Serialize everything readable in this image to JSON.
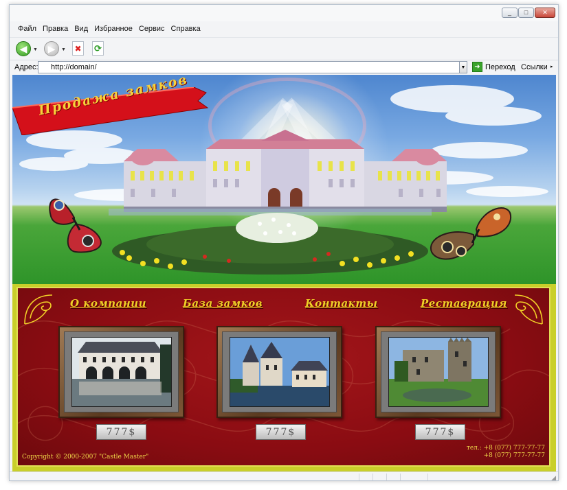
{
  "window": {
    "controls": {
      "minimize": "_",
      "maximize": "□",
      "close": "✕"
    }
  },
  "menu": [
    "Файл",
    "Правка",
    "Вид",
    "Избранное",
    "Сервис",
    "Справка"
  ],
  "toolbar": {
    "back_icon": "back-arrow-icon",
    "forward_icon": "forward-arrow-icon",
    "stop_icon": "stop-icon",
    "refresh_icon": "refresh-icon"
  },
  "address": {
    "label": "Адрес:",
    "url": "http://domain/",
    "go_label": "Переход",
    "links_label": "Ссылки"
  },
  "site": {
    "banner_title": "Продажа замков",
    "nav": [
      "О компании",
      "База замков",
      "Контакты",
      "Реставрация"
    ],
    "products": [
      {
        "price": "777$"
      },
      {
        "price": "777$"
      },
      {
        "price": "777$"
      }
    ],
    "copyright": "Copyright © 2000-2007 \"Castle Master\"",
    "phone_1": "тел.: +8 (077) 777-77-77",
    "phone_2": "+8 (077) 777-77-77"
  },
  "colors": {
    "panel_red": "#8a0c12",
    "gold_text": "#f1d027",
    "ribbon_red": "#d4101a"
  }
}
